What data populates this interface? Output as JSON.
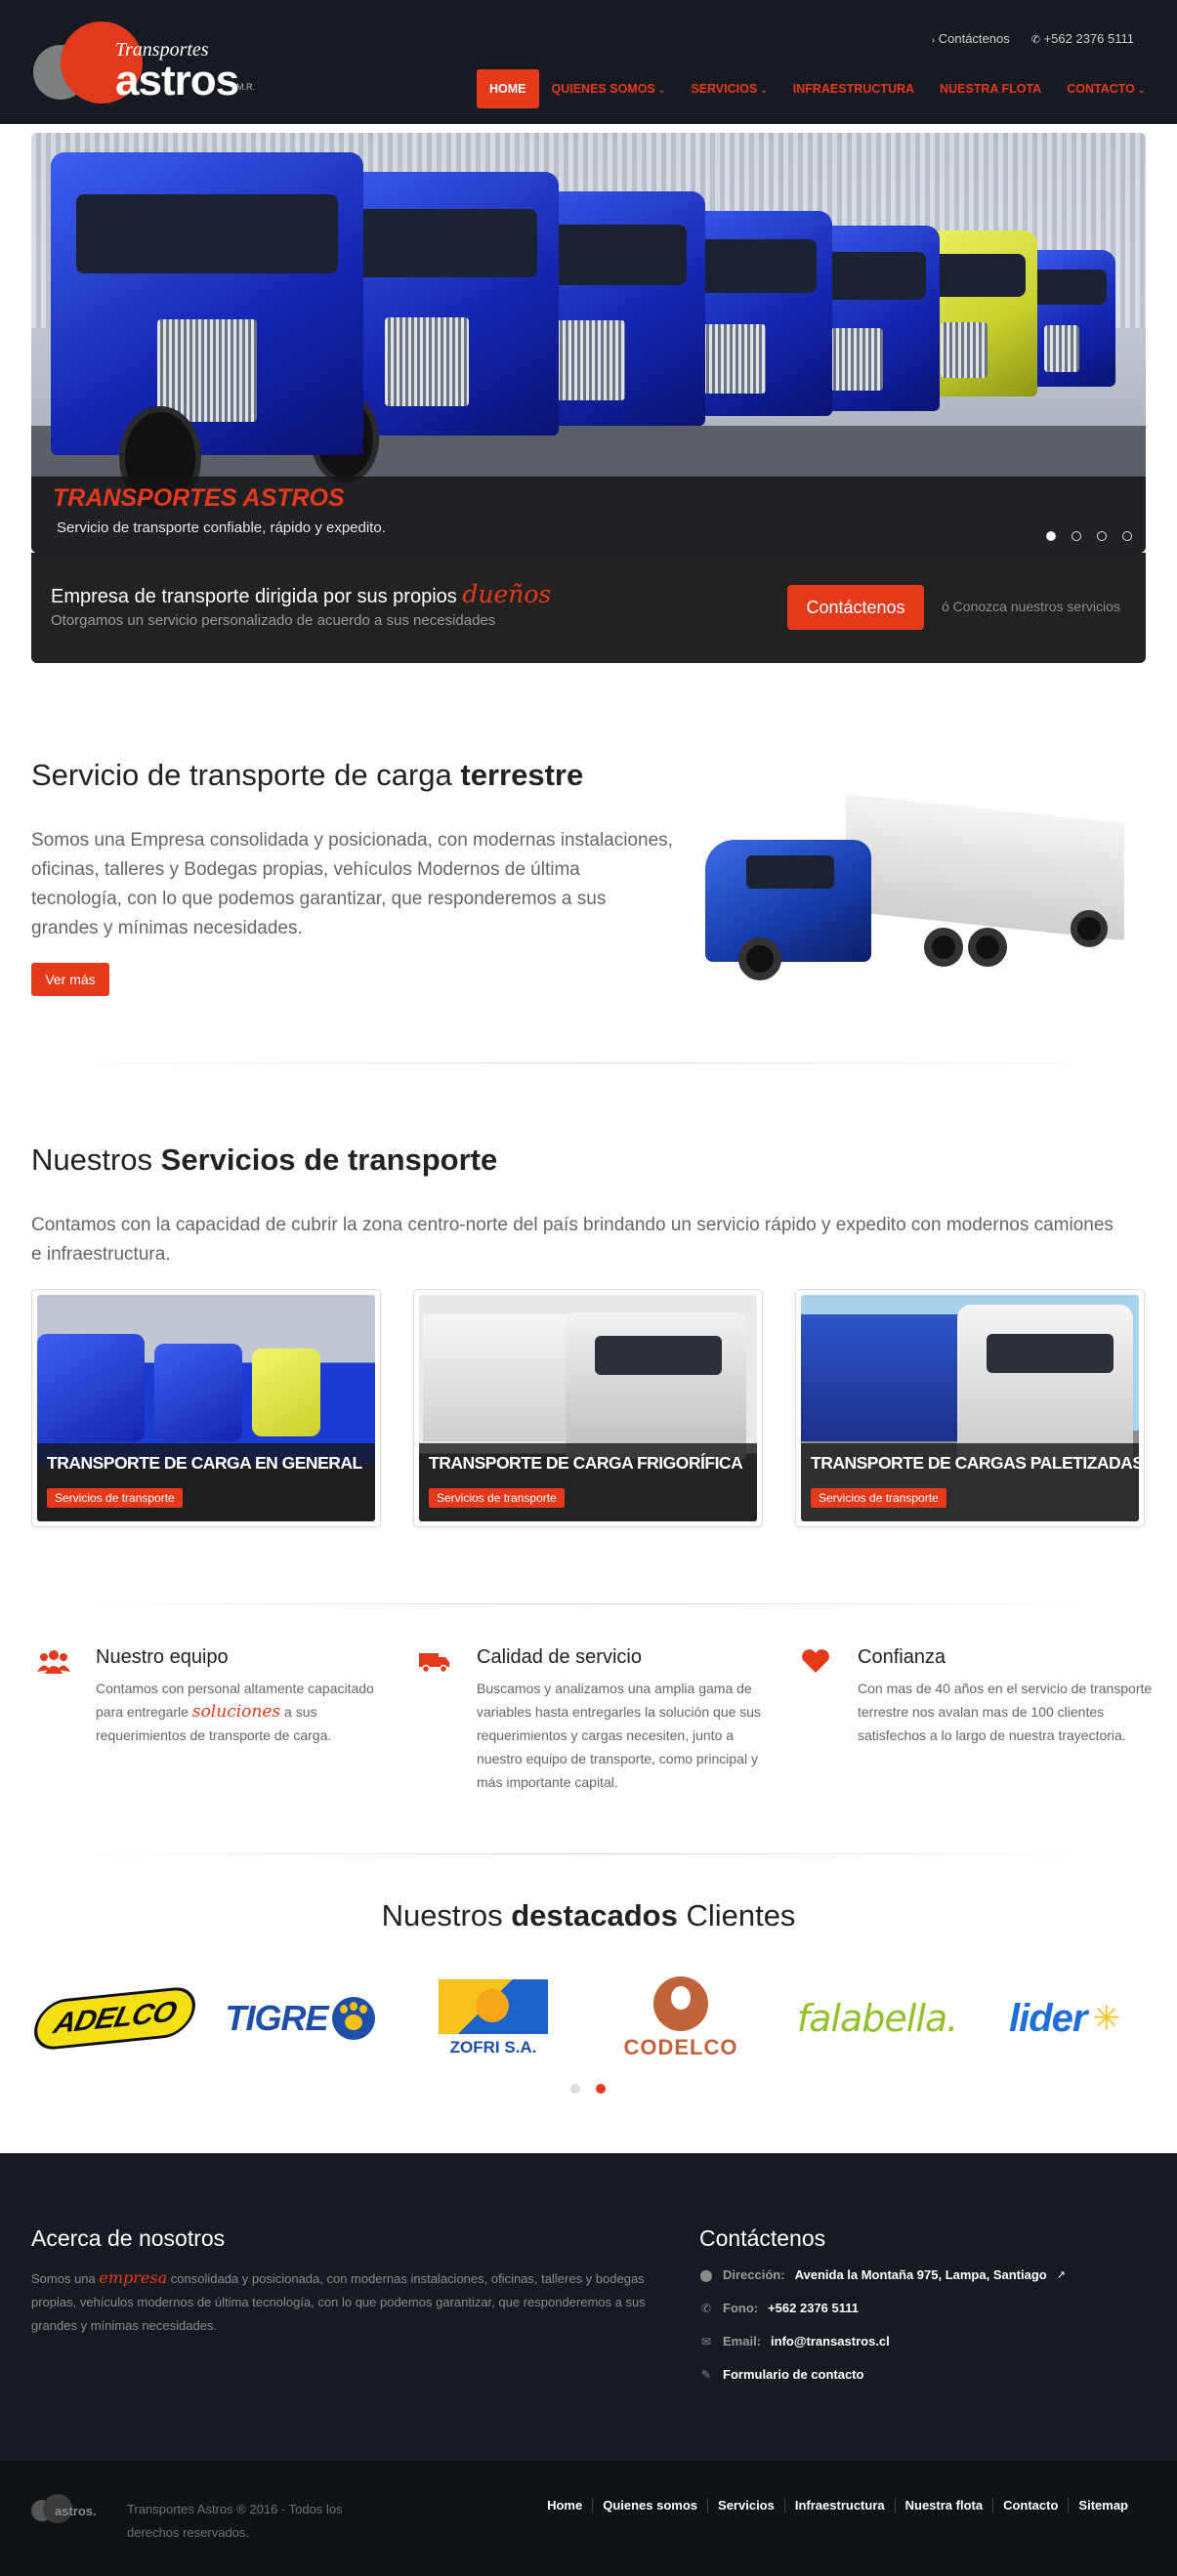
{
  "header": {
    "logo_small": "Transportes",
    "logo_big": "astros",
    "logo_suffix": "M.R.",
    "top_contact": "Contáctenos",
    "top_phone": "+562 2376 5111",
    "nav": [
      {
        "label": "HOME"
      },
      {
        "label": "QUIENES SOMOS"
      },
      {
        "label": "SERVICIOS"
      },
      {
        "label": "INFRAESTRUCTURA"
      },
      {
        "label": "NUESTRA FLOTA"
      },
      {
        "label": "CONTACTO"
      }
    ]
  },
  "slider": {
    "title": "TRANSPORTES ASTROS",
    "subtitle": "Servicio de transporte confiable, rápido y expedito.",
    "current_slide": 1,
    "slide_count": 4
  },
  "cta": {
    "heading": "Empresa de transporte dirigida por sus propios",
    "heading_hand": "dueños",
    "text": "Otorgamos un servicio personalizado de acuerdo a sus necesidades",
    "button": "Contáctenos",
    "alt": "ó Conozca nuestros servicios"
  },
  "intro": {
    "title_normal": "Servicio de transporte de carga",
    "title_bold": "terrestre",
    "text": "Somos una Empresa consolidada y posicionada, con modernas instalaciones, oficinas, talleres y Bodegas propias, vehículos Modernos de última tecnología, con lo que podemos garantizar, que responderemos a sus grandes y mínimas necesidades.",
    "button": "Ver más"
  },
  "services": {
    "title_normal": "Nuestros",
    "title_bold": "Servicios de transporte",
    "text": "Contamos con la capacidad de cubrir la zona centro-norte del país brindando un servicio rápido y expedito con modernos camiones e infraestructura.",
    "cards": [
      {
        "title": "TRANSPORTE DE CARGA EN GENERAL",
        "tag": "Servicios de transporte"
      },
      {
        "title": "TRANSPORTE DE CARGA FRIGORÍFICA",
        "tag": "Servicios de transporte"
      },
      {
        "title": "TRANSPORTE DE CARGAS PALETIZADAS",
        "tag": "Servicios de transporte"
      }
    ]
  },
  "features": [
    {
      "title": "Nuestro equipo",
      "text_a": "Contamos con personal altamente capacitado para entregarle",
      "hand": "soluciones",
      "text_b": "a sus requerimientos de transporte de carga.",
      "icon": "users-icon"
    },
    {
      "title": "Calidad de servicio",
      "text_a": "Buscamos y analizamos una amplia gama de variables hasta entregarles la solución que sus requerimientos y cargas necesiten, junto a nuestro equipo de transporte, como principal y más importante capital.",
      "hand": "",
      "text_b": "",
      "icon": "truck-icon"
    },
    {
      "title": "Confianza",
      "text_a": "Con mas de 40 años en el servicio de transporte terrestre nos avalan mas de 100 clientes satisfechos a lo largo de nuestra trayectoria.",
      "hand": "",
      "text_b": "",
      "icon": "heart-icon"
    }
  ],
  "clients": {
    "title_a": "Nuestros",
    "title_bold": "destacados",
    "title_b": "Clientes",
    "logos": [
      "ADELCO",
      "TIGRE",
      "ZOFRI S.A.",
      "CODELCO",
      "falabella.",
      "lider"
    ],
    "current_page": 2,
    "page_count": 2
  },
  "footer": {
    "about_title": "Acerca de nosotros",
    "about_a": "Somos una",
    "about_hand": "empresa",
    "about_b": "consolidada y posicionada, con modernas instalaciones, oficinas, talleres y bodegas propias, vehículos modernos de última tecnología, con lo que podemos garantizar, que responderemos a sus grandes y mínimas necesidades.",
    "contact_title": "Contáctenos",
    "address_label": "Dirección:",
    "address": "Avenida la Montaña 975, Lampa, Santiago",
    "phone_label": "Fono:",
    "phone": "+562 2376 5111",
    "email_label": "Email:",
    "email": "info@transastros.cl",
    "form_link": "Formulario de contacto",
    "copyright": "Transportes Astros ® 2016 - Todos los derechos reservados.",
    "mini_logo": "astros.",
    "links": [
      "Home",
      "Quienes somos",
      "Servicios",
      "Infraestructura",
      "Nuestra flota",
      "Contacto",
      "Sitemap"
    ]
  },
  "colors": {
    "accent": "#e5391c",
    "dark": "#171b21"
  }
}
